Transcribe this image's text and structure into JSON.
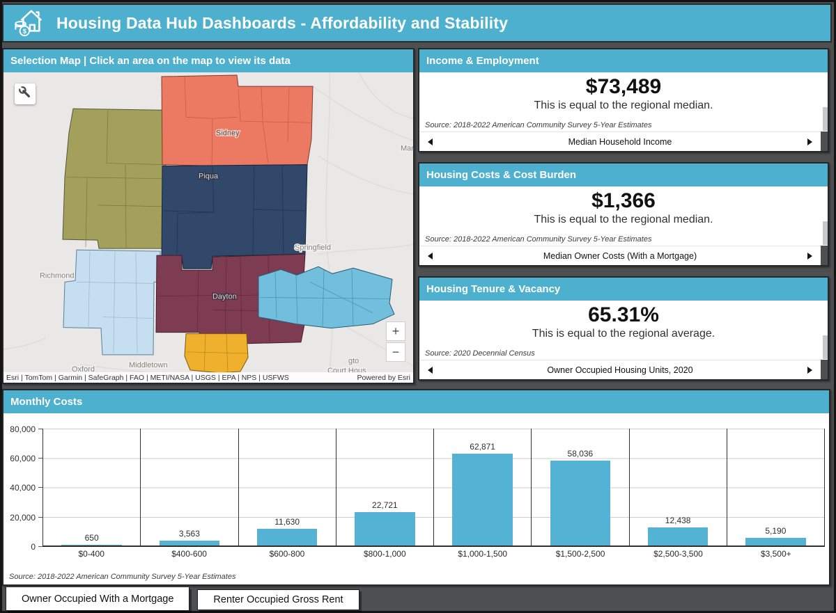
{
  "app": {
    "title": "Housing Data Hub Dashboards - Affordability and Stability"
  },
  "map_panel": {
    "header": "Selection Map | Click an area on the map to view its data",
    "attribution": "Esri | TomTom | Garmin | SafeGraph | FAO | METI/NASA | USGS | EPA | NPS | USFWS",
    "powered_by": "Powered by Esri",
    "zoom_in": "+",
    "zoom_out": "−",
    "city_labels": {
      "sidney": "Sidney",
      "piqua": "Piqua",
      "springfield": "Springfield",
      "richmond": "Richmond",
      "dayton": "Dayton",
      "oxford": "Oxford",
      "middletown": "Middletown",
      "marysville_partial": "Mar",
      "wch_partial_top": "gto",
      "wch_partial_bottom": "Court Hous"
    },
    "region_colors": {
      "north_region": "#ec7a63",
      "west_region": "#a2a05a",
      "central_region": "#31486b",
      "dayton_region": "#7e3c52",
      "southwest_region": "#c5def0",
      "east_region": "#72bedd",
      "south_region": "#efb02e"
    }
  },
  "stat_panels": [
    {
      "header": "Income & Employment",
      "value": "$73,489",
      "subtitle": "This is equal to the regional median.",
      "source": "Source: 2018-2022 American Community Survey 5-Year Estimates",
      "carousel_label": "Median Household Income"
    },
    {
      "header": "Housing Costs & Cost Burden",
      "value": "$1,366",
      "subtitle": "This is equal to the regional median.",
      "source": "Source: 2018-2022 American Community Survey 5-Year Estimates",
      "carousel_label": "Median Owner Costs (With a Mortgage)"
    },
    {
      "header": "Housing Tenure & Vacancy",
      "value": "65.31%",
      "subtitle": "This is equal to the regional average.",
      "source": "Source: 2020 Decennial Census",
      "carousel_label": "Owner Occupied Housing Units, 2020"
    }
  ],
  "chart_panel": {
    "header": "Monthly Costs",
    "source": "Source: 2018-2022 American Community Survey 5-Year Estimates",
    "tabs": [
      {
        "label": "Owner Occupied With a Mortgage",
        "active": true
      },
      {
        "label": "Renter Occupied Gross Rent",
        "active": false
      }
    ]
  },
  "chart_data": {
    "type": "bar",
    "title": "Monthly Costs",
    "categories": [
      "$0-400",
      "$400-600",
      "$600-800",
      "$800-1,000",
      "$1,000-1,500",
      "$1,500-2,500",
      "$2,500-3,500",
      "$3,500+"
    ],
    "values": [
      650,
      3563,
      11630,
      22721,
      62871,
      58036,
      12438,
      5190
    ],
    "value_labels": [
      "650",
      "3,563",
      "11,630",
      "22,721",
      "62,871",
      "58,036",
      "12,438",
      "5,190"
    ],
    "xlabel": "",
    "ylabel": "",
    "ylim": [
      0,
      80000
    ],
    "yticks": [
      "0",
      "20,000",
      "40,000",
      "60,000",
      "80,000"
    ],
    "grid": true,
    "legend": "none",
    "bar_color": "#54b3d4"
  },
  "colors": {
    "accent_teal": "#4db0ce",
    "background_gray": "#4e4f51",
    "border_black": "#141414"
  }
}
